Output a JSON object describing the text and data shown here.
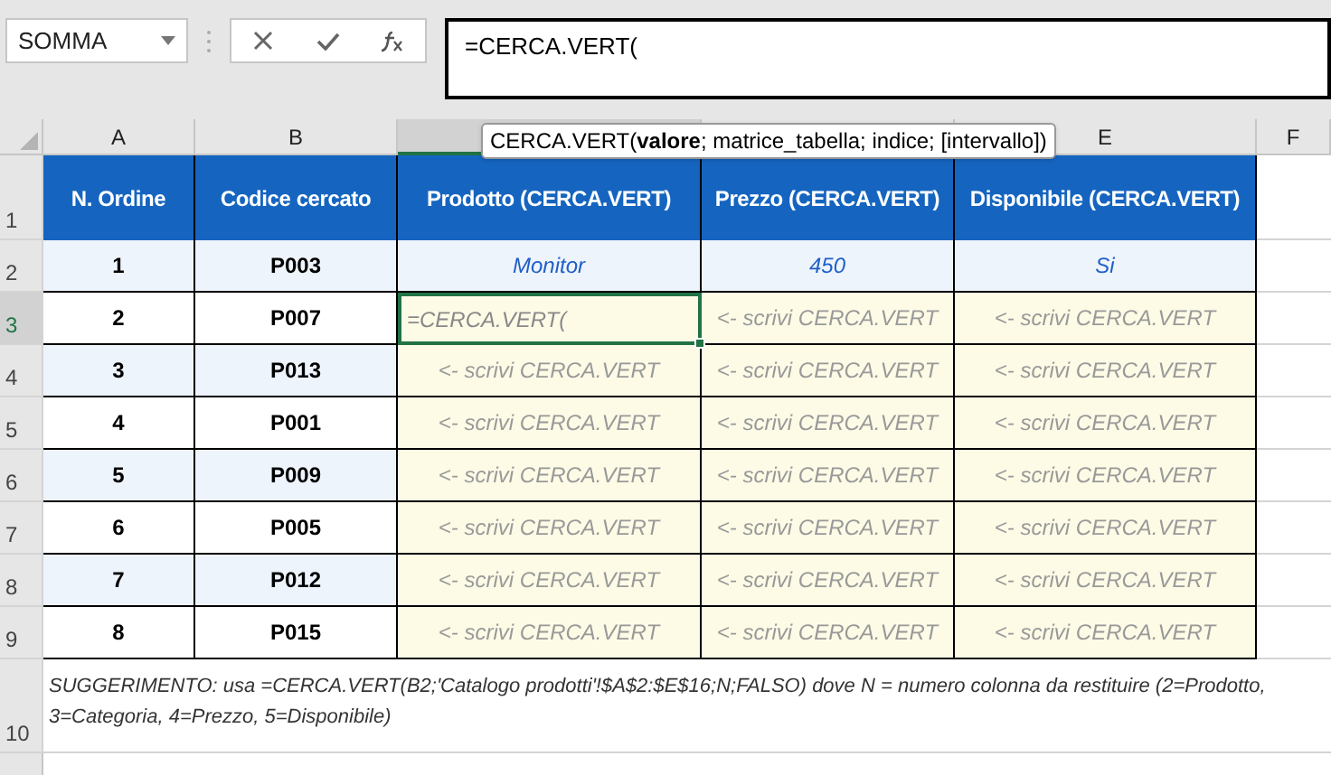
{
  "name_box": {
    "value": "SOMMA"
  },
  "formula_bar": {
    "value": "=CERCA.VERT("
  },
  "tooltip": {
    "text": "CERCA.VERT(**valore**; matrice_tabella; indice; [intervallo])"
  },
  "columns": [
    {
      "label": "A",
      "selected": false
    },
    {
      "label": "B",
      "selected": false
    },
    {
      "selected": true
    },
    {
      "selected": false
    },
    {
      "label": "E",
      "selected": false
    },
    {
      "label": "F",
      "selected": false
    }
  ],
  "header_row": {
    "number": "1",
    "cells": [
      "N. Ordine",
      "Codice cercato",
      "Prodotto (CERCA.VERT)",
      "Prezzo (CERCA.VERT)",
      "Disponibile (CERCA.VERT)"
    ]
  },
  "rows": [
    {
      "number": "2",
      "selected": false,
      "striped": true,
      "order": "1",
      "code": "P003",
      "lookups": [
        {
          "kind": "result",
          "text": "Monitor"
        },
        {
          "kind": "result",
          "text": "450"
        },
        {
          "kind": "result",
          "text": "Si"
        }
      ]
    },
    {
      "number": "3",
      "selected": true,
      "striped": false,
      "order": "2",
      "code": "P007",
      "lookups": [
        {
          "kind": "editing",
          "text": "=CERCA.VERT("
        },
        {
          "kind": "placeholder",
          "text": "<- scrivi CERCA.VERT"
        },
        {
          "kind": "placeholder",
          "text": "<- scrivi CERCA.VERT"
        }
      ]
    },
    {
      "number": "4",
      "selected": false,
      "striped": true,
      "order": "3",
      "code": "P013",
      "lookups": [
        {
          "kind": "placeholder",
          "text": "<- scrivi CERCA.VERT"
        },
        {
          "kind": "placeholder",
          "text": "<- scrivi CERCA.VERT"
        },
        {
          "kind": "placeholder",
          "text": "<- scrivi CERCA.VERT"
        }
      ]
    },
    {
      "number": "5",
      "selected": false,
      "striped": false,
      "order": "4",
      "code": "P001",
      "lookups": [
        {
          "kind": "placeholder",
          "text": "<- scrivi CERCA.VERT"
        },
        {
          "kind": "placeholder",
          "text": "<- scrivi CERCA.VERT"
        },
        {
          "kind": "placeholder",
          "text": "<- scrivi CERCA.VERT"
        }
      ]
    },
    {
      "number": "6",
      "selected": false,
      "striped": true,
      "order": "5",
      "code": "P009",
      "lookups": [
        {
          "kind": "placeholder",
          "text": "<- scrivi CERCA.VERT"
        },
        {
          "kind": "placeholder",
          "text": "<- scrivi CERCA.VERT"
        },
        {
          "kind": "placeholder",
          "text": "<- scrivi CERCA.VERT"
        }
      ]
    },
    {
      "number": "7",
      "selected": false,
      "striped": false,
      "order": "6",
      "code": "P005",
      "lookups": [
        {
          "kind": "placeholder",
          "text": "<- scrivi CERCA.VERT"
        },
        {
          "kind": "placeholder",
          "text": "<- scrivi CERCA.VERT"
        },
        {
          "kind": "placeholder",
          "text": "<- scrivi CERCA.VERT"
        }
      ]
    },
    {
      "number": "8",
      "selected": false,
      "striped": true,
      "order": "7",
      "code": "P012",
      "lookups": [
        {
          "kind": "placeholder",
          "text": "<- scrivi CERCA.VERT"
        },
        {
          "kind": "placeholder",
          "text": "<- scrivi CERCA.VERT"
        },
        {
          "kind": "placeholder",
          "text": "<- scrivi CERCA.VERT"
        }
      ]
    },
    {
      "number": "9",
      "selected": false,
      "striped": false,
      "order": "8",
      "code": "P015",
      "lookups": [
        {
          "kind": "placeholder",
          "text": "<- scrivi CERCA.VERT"
        },
        {
          "kind": "placeholder",
          "text": "<- scrivi CERCA.VERT"
        },
        {
          "kind": "placeholder",
          "text": "<- scrivi CERCA.VERT"
        }
      ]
    }
  ],
  "note_row": {
    "number": "10",
    "text": "SUGGERIMENTO: usa =CERCA.VERT(B2;'Catalogo prodotti'!$A$2:$E$16;N;FALSO) dove N = numero colonna da restituire (2=Prodotto, 3=Categoria, 4=Prezzo, 5=Disponibile)"
  }
}
